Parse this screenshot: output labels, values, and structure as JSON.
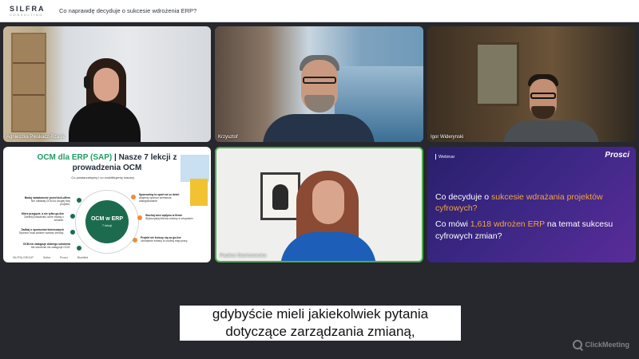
{
  "header": {
    "logo_main": "SILFRA",
    "logo_sub": "CONSULTING",
    "title": "Co naprawdę decyduje o sukcesie wdrożenia ERP?"
  },
  "participants": [
    {
      "name": "Agnieszka Pleskacz-Rzasik"
    },
    {
      "name": "Krzysztof"
    },
    {
      "name": "Igor Widerynski"
    },
    {
      "name": ""
    },
    {
      "name": "Paulina Staniszewska"
    }
  ],
  "slide_ocm": {
    "title_prefix": "OCM dla ERP (SAP)",
    "title_suffix": " | Nasze 7 lekcji z prowadzenia OCM",
    "subtitle": "Co powtarzalnymy i co znobilitujemy inaczej.",
    "center_main": "OCM w ERP",
    "center_sub": "7 lekcji",
    "items": [
      {
        "title": "Buduj świadomość przed kick-offem",
        "text": "Nie odkładaj OCM do drugiej fazy projektu."
      },
      {
        "title": "Mierz przyjęcie, a nie tylko go-live",
        "text": "Zdefiniuj wskaźniki, które mówią o zmianie."
      },
      {
        "title": "Zadbaj o sponsorów biznesowych",
        "text": "Sponsor musi widzieć wartość zmiany."
      },
      {
        "title": "OCM nie zastępuje dobrego szkolenia",
        "text": "Ale szkolenie nie zastępuje OCM."
      },
      {
        "title": "Sponsoring to sport na co dzień",
        "text": "Aktywny sponsor wzmacnia zaangażowanie."
      },
      {
        "title": "Słuchaj sieci wpływu w firmie",
        "text": "Wykorzystaj liderów zmiany w zespołach."
      },
      {
        "title": "Projekt nie kończy się na go-live",
        "text": "Utrwalanie zmiany to osobny etap pracy."
      }
    ],
    "logos": [
      "SILFRA GROUP",
      "Seltra",
      "Prosci",
      "Bluefield"
    ]
  },
  "webinar": {
    "label": "Webinar",
    "brand": "Prosci",
    "h1_a": "Co decyduje o ",
    "h1_hl": "sukcesie wdrażania projektów cyfrowych?",
    "h2_a": "Co mówi ",
    "h2_hl": "1,618 wdrożen ERP",
    "h2_b": " na temat sukcesu cyfrowych zmian?"
  },
  "captions": {
    "line1": "gdybyście mieli jakiekolwiek pytania",
    "line2": "dotyczące zarządzania zmianą,"
  },
  "watermark": "ClickMeeting"
}
